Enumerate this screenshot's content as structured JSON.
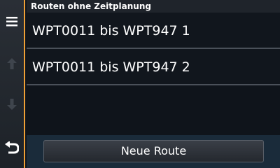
{
  "header": {
    "title": "Routen ohne Zeitplanung"
  },
  "routes": [
    {
      "label": "WPT0011 bis WPT947 1"
    },
    {
      "label": "WPT0011 bis WPT947 2"
    }
  ],
  "sidebar": {
    "menu_icon": "hamburger-menu-icon",
    "up_icon": "arrow-up-icon",
    "down_icon": "arrow-down-icon",
    "back_icon": "back-arrow-icon"
  },
  "actions": {
    "new_route_label": "Neue Route"
  },
  "colors": {
    "accent": "#f0a035",
    "background": "#0f141b",
    "divider": "#4a5059"
  }
}
